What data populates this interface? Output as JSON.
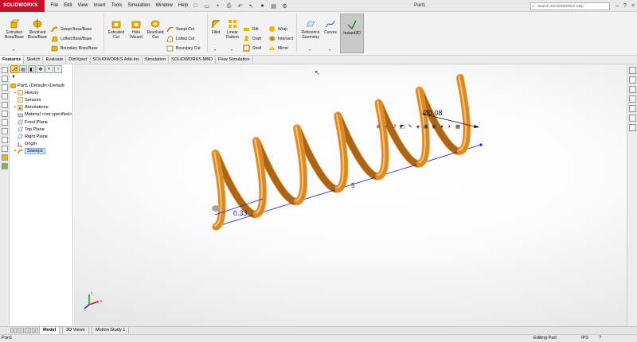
{
  "app": {
    "logo_text": "SOLIDWORKS",
    "document_title": "Part1",
    "search_placeholder": "Search SOLIDWORKS Help",
    "brand_color": "#c8102e"
  },
  "menu": [
    "File",
    "Edit",
    "View",
    "Insert",
    "Tools",
    "Simulation",
    "Window",
    "Help"
  ],
  "ribbon": {
    "extruded_boss_line1": "Extruded",
    "extruded_boss_line2": "Boss/Base",
    "revolved_boss_line1": "Revolved",
    "revolved_boss_line2": "Boss/Base",
    "swept_boss": "Swept Boss/Base",
    "lofted_boss": "Lofted Boss/Base",
    "boundary_boss": "Boundary Boss/Base",
    "extruded_cut_line1": "Extruded",
    "extruded_cut_line2": "Cut",
    "hole_wizard_line1": "Hole",
    "hole_wizard_line2": "Wizard",
    "revolved_cut_line1": "Revolved",
    "revolved_cut_line2": "Cut",
    "swept_cut": "Swept Cut",
    "lofted_cut": "Lofted Cut",
    "boundary_cut": "Boundary Cut",
    "fillet": "Fillet",
    "linear_pattern_line1": "Linear",
    "linear_pattern_line2": "Pattern",
    "rib": "Rib",
    "draft": "Draft",
    "shell": "Shell",
    "wrap": "Wrap",
    "intersect": "Intersect",
    "mirror": "Mirror",
    "reference_geometry_line1": "Reference",
    "reference_geometry_line2": "Geometry",
    "curves": "Curves",
    "instant3d": "Instant3D"
  },
  "tabs": [
    "Features",
    "Sketch",
    "Evaluate",
    "DimXpert",
    "SOLIDWORKS Add-Ins",
    "Simulation",
    "SOLIDWORKS MBD",
    "Flow Simulation"
  ],
  "tree": {
    "part": "Part1  (Default<<Default",
    "items": [
      "History",
      "Sensors",
      "Annotations",
      "Material <not specified>",
      "Front Plane",
      "Top Plane",
      "Right Plane",
      "Origin",
      "Sweep1"
    ]
  },
  "dimensions": {
    "diameter": "Ø0.08",
    "pitch": "0.33",
    "length": "5"
  },
  "model": {
    "spring_color": "#d78a2a",
    "highlight_color": "#ff9a1f",
    "axis_color": "#1a1ac8"
  },
  "bottom_tabs": [
    "Model",
    "3D Views",
    "Motion Study 1"
  ],
  "status": {
    "doc": "Part1",
    "mode": "Editing Part",
    "units": "IPS"
  }
}
